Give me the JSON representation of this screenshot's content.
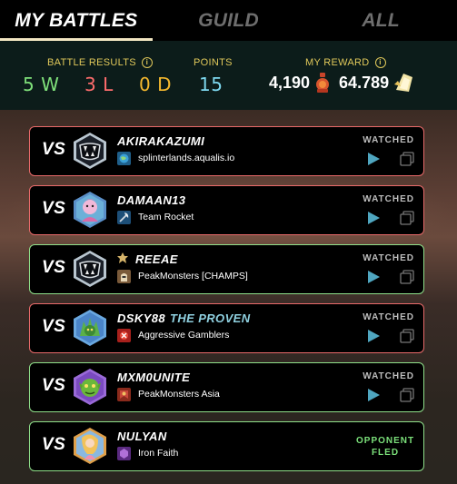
{
  "tabs": [
    {
      "label": "MY BATTLES",
      "active": true
    },
    {
      "label": "GUILD",
      "active": false
    },
    {
      "label": "ALL",
      "active": false
    }
  ],
  "stats": {
    "battle_results_label": "BATTLE RESULTS",
    "wins": "5 W",
    "losses": "3 L",
    "draws": "0 D",
    "points_label": "POINTS",
    "points": "15",
    "reward_label": "MY REWARD",
    "reward_potions": "4,190",
    "reward_sps": "64.789"
  },
  "battles": [
    {
      "vs": "VS",
      "opponent": "AKIRAKAZUMI",
      "title": "",
      "guild": "splinterlands.aqualis.io",
      "result": "loss",
      "status": "WATCHED",
      "avatar_icon": "fanged-monster-avatar-icon",
      "guild_icon": "world-guild-icon"
    },
    {
      "vs": "VS",
      "opponent": "DAMAAN13",
      "title": "",
      "guild": "Team Rocket",
      "result": "loss",
      "status": "WATCHED",
      "avatar_icon": "pink-character-avatar-icon",
      "guild_icon": "axe-guild-icon"
    },
    {
      "vs": "VS",
      "opponent": "REEAE",
      "title": "",
      "guild": "PeakMonsters [CHAMPS]",
      "result": "win",
      "status": "WATCHED",
      "avatar_icon": "fanged-monster-avatar-icon",
      "guild_icon": "knight-guild-icon"
    },
    {
      "vs": "VS",
      "opponent": "DSKY88",
      "title": "THE PROVEN",
      "guild": "Aggressive Gamblers",
      "result": "loss",
      "status": "WATCHED",
      "avatar_icon": "green-creature-avatar-icon",
      "guild_icon": "red-guild-icon"
    },
    {
      "vs": "VS",
      "opponent": "MXM0UNITE",
      "title": "",
      "guild": "PeakMonsters Asia",
      "result": "win",
      "status": "WATCHED",
      "avatar_icon": "goblin-avatar-icon",
      "guild_icon": "banner-guild-icon"
    },
    {
      "vs": "VS",
      "opponent": "NULYAN",
      "title": "",
      "guild": "Iron Faith",
      "result": "win",
      "status": "OPPONENT FLED",
      "avatar_icon": "mermaid-avatar-icon",
      "guild_icon": "purple-guild-icon"
    }
  ],
  "colors": {
    "win_border": "#8fe08a",
    "loss_border": "#e96a6a",
    "label_gold": "#e0c85a",
    "points_cyan": "#7ed9f0"
  }
}
